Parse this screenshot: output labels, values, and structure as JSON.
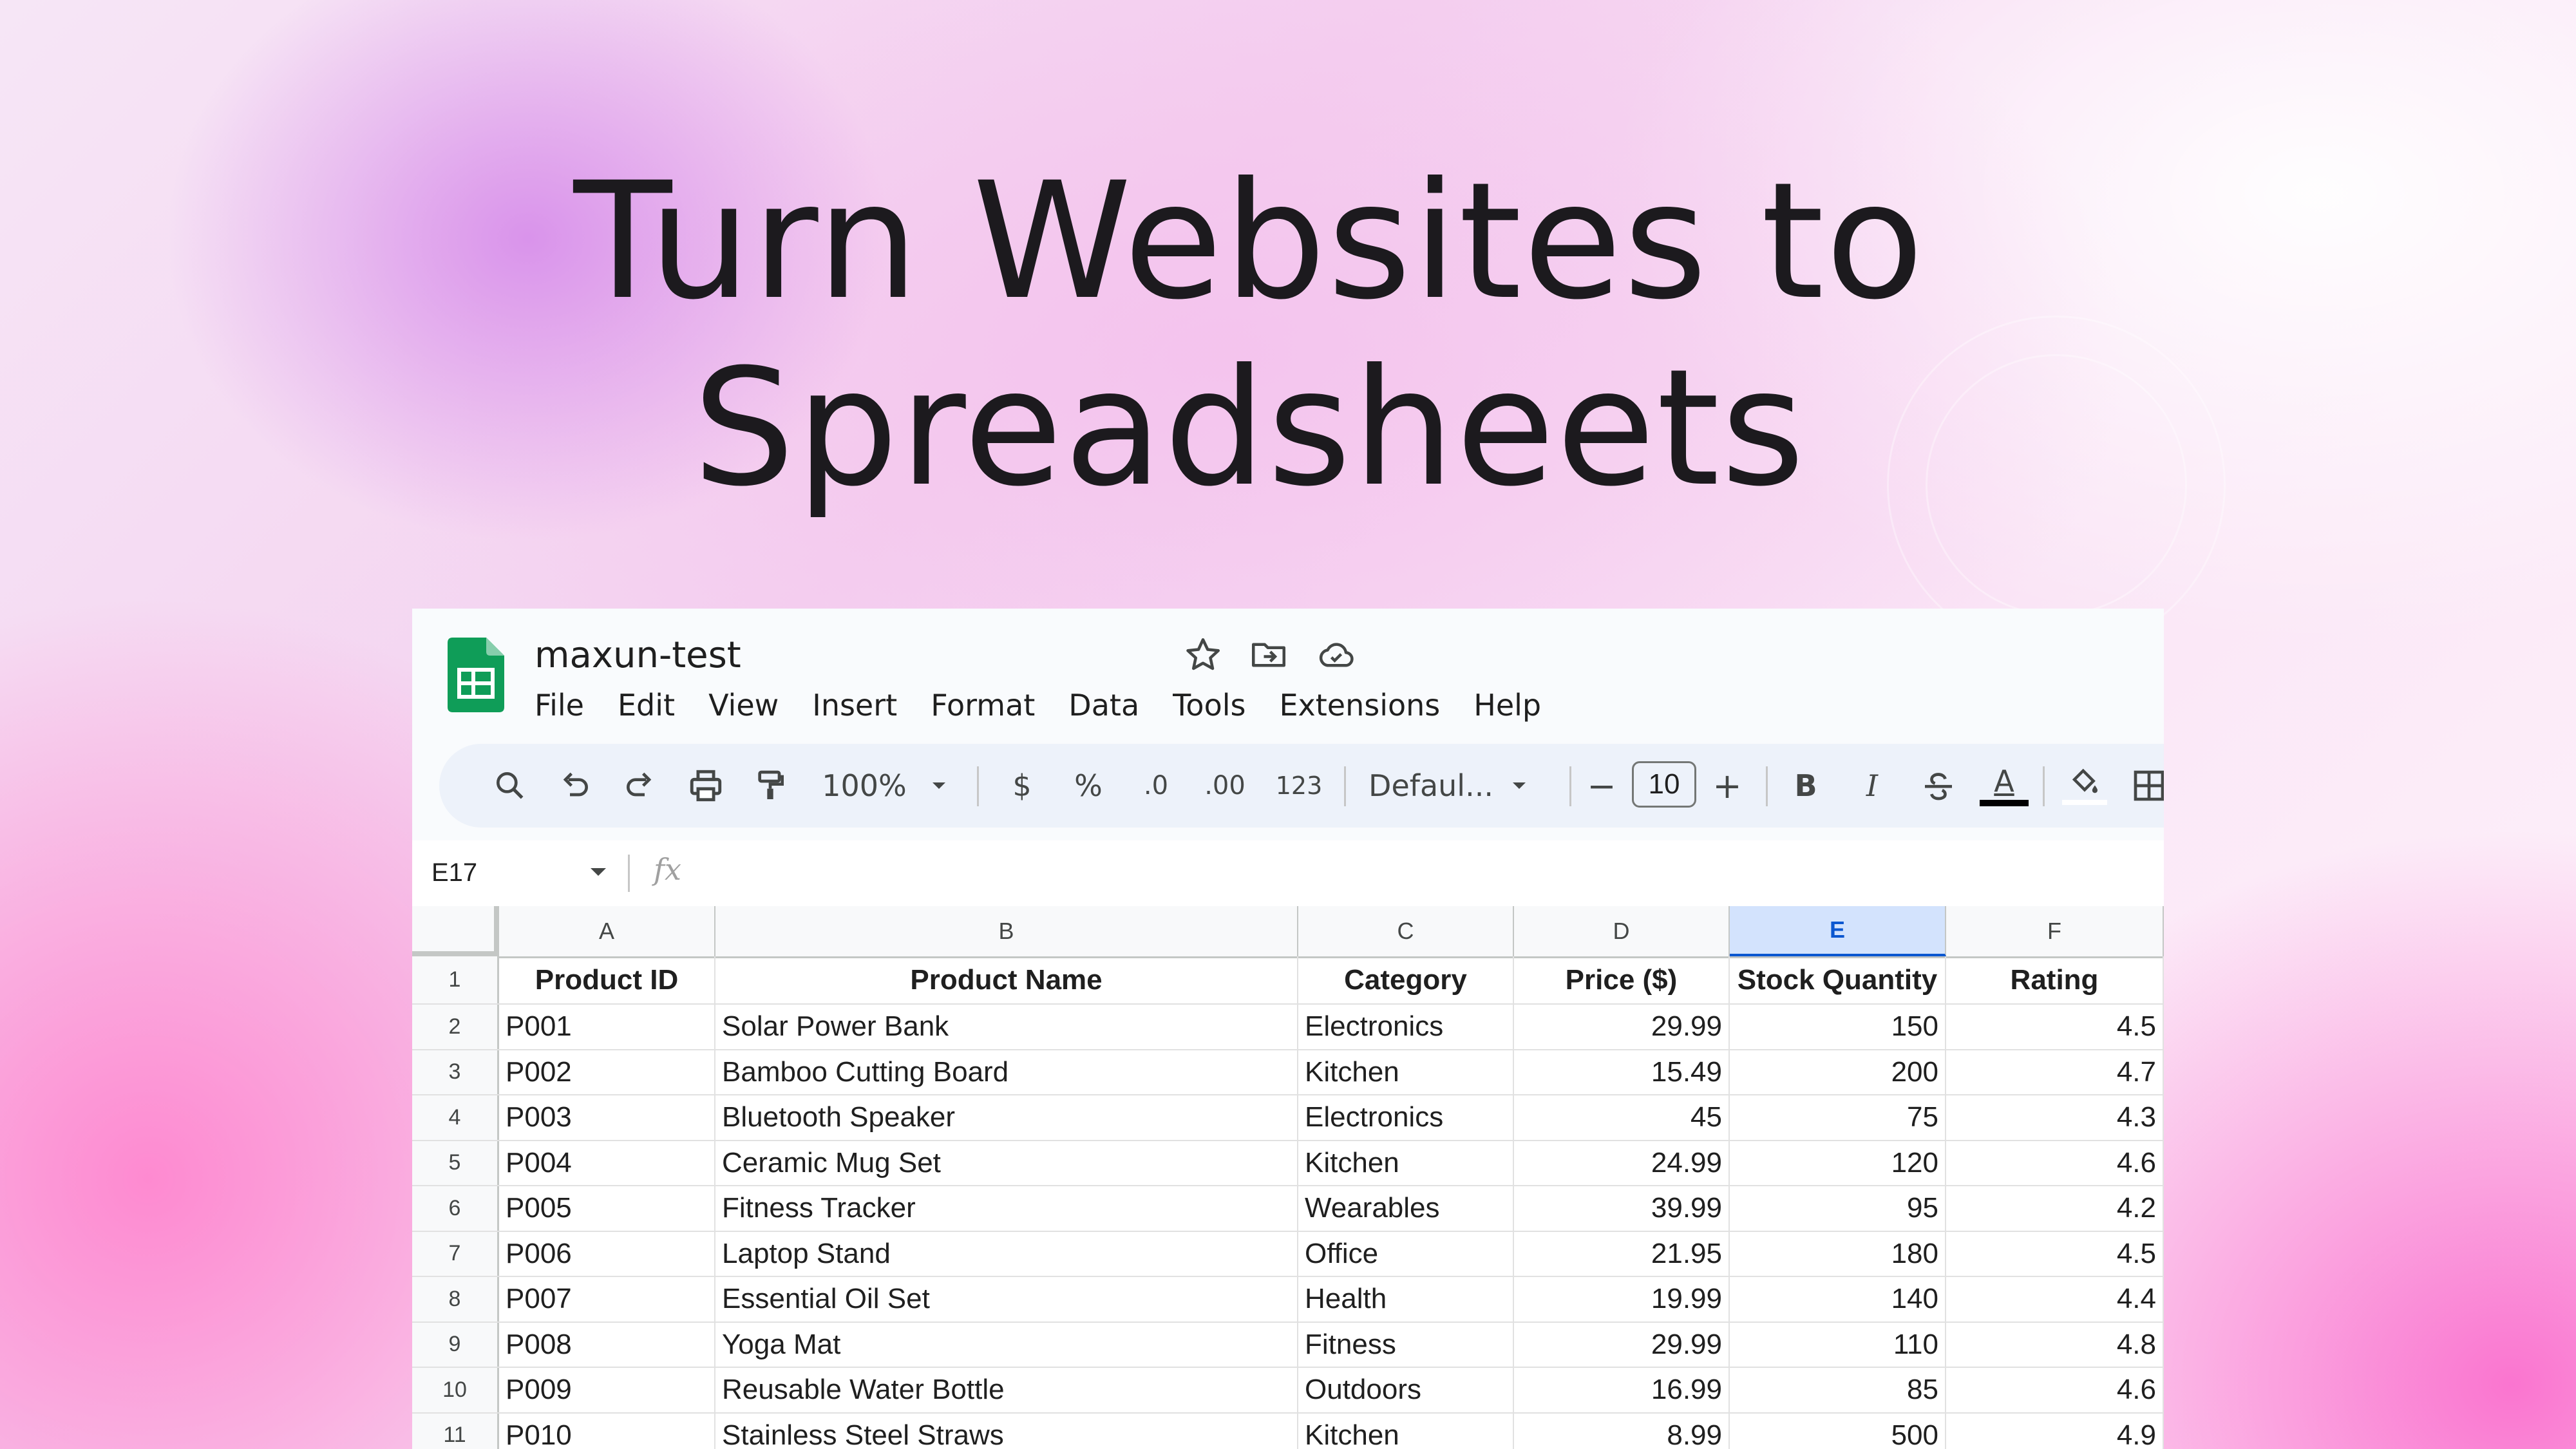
{
  "headline": {
    "line1": "Turn Websites to",
    "line2": "Spreadsheets"
  },
  "app": {
    "doc_title": "maxun-test",
    "icons": [
      "star-icon",
      "move-to-folder-icon",
      "cloud-saved-icon"
    ],
    "menu": [
      "File",
      "Edit",
      "View",
      "Insert",
      "Format",
      "Data",
      "Tools",
      "Extensions",
      "Help"
    ]
  },
  "toolbar": {
    "zoom": "100%",
    "currency": "$",
    "percent": "%",
    "decrease_decimal": ".0",
    "increase_decimal": ".00",
    "number_format": "123",
    "font": "Defaul...",
    "font_size": "10",
    "minus": "−",
    "plus": "+",
    "bold": "B",
    "italic": "I",
    "text_color": "A",
    "text_color_value": "#000000"
  },
  "formula_bar": {
    "name_box": "E17",
    "fx": "fx"
  },
  "sheet": {
    "columns": [
      "A",
      "B",
      "C",
      "D",
      "E",
      "F"
    ],
    "selected_column": "E",
    "header": [
      "Product ID",
      "Product Name",
      "Category",
      "Price ($)",
      "Stock Quantity",
      "Rating"
    ],
    "rows": [
      {
        "n": "2",
        "cells": [
          "P001",
          "Solar Power Bank",
          "Electronics",
          "29.99",
          "150",
          "4.5"
        ]
      },
      {
        "n": "3",
        "cells": [
          "P002",
          "Bamboo Cutting Board",
          "Kitchen",
          "15.49",
          "200",
          "4.7"
        ]
      },
      {
        "n": "4",
        "cells": [
          "P003",
          "Bluetooth Speaker",
          "Electronics",
          "45",
          "75",
          "4.3"
        ]
      },
      {
        "n": "5",
        "cells": [
          "P004",
          "Ceramic Mug Set",
          "Kitchen",
          "24.99",
          "120",
          "4.6"
        ]
      },
      {
        "n": "6",
        "cells": [
          "P005",
          "Fitness Tracker",
          "Wearables",
          "39.99",
          "95",
          "4.2"
        ]
      },
      {
        "n": "7",
        "cells": [
          "P006",
          "Laptop Stand",
          "Office",
          "21.95",
          "180",
          "4.5"
        ]
      },
      {
        "n": "8",
        "cells": [
          "P007",
          "Essential Oil Set",
          "Health",
          "19.99",
          "140",
          "4.4"
        ]
      },
      {
        "n": "9",
        "cells": [
          "P008",
          "Yoga Mat",
          "Fitness",
          "29.99",
          "110",
          "4.8"
        ]
      },
      {
        "n": "10",
        "cells": [
          "P009",
          "Reusable Water Bottle",
          "Outdoors",
          "16.99",
          "85",
          "4.6"
        ]
      },
      {
        "n": "11",
        "cells": [
          "P010",
          "Stainless Steel Straws",
          "Kitchen",
          "8.99",
          "500",
          "4.9"
        ]
      }
    ]
  },
  "colors": {
    "sheets_green": "#0f9d58",
    "selected_column": "#d3e3fd",
    "toolbar_bg": "#edf2fa"
  }
}
